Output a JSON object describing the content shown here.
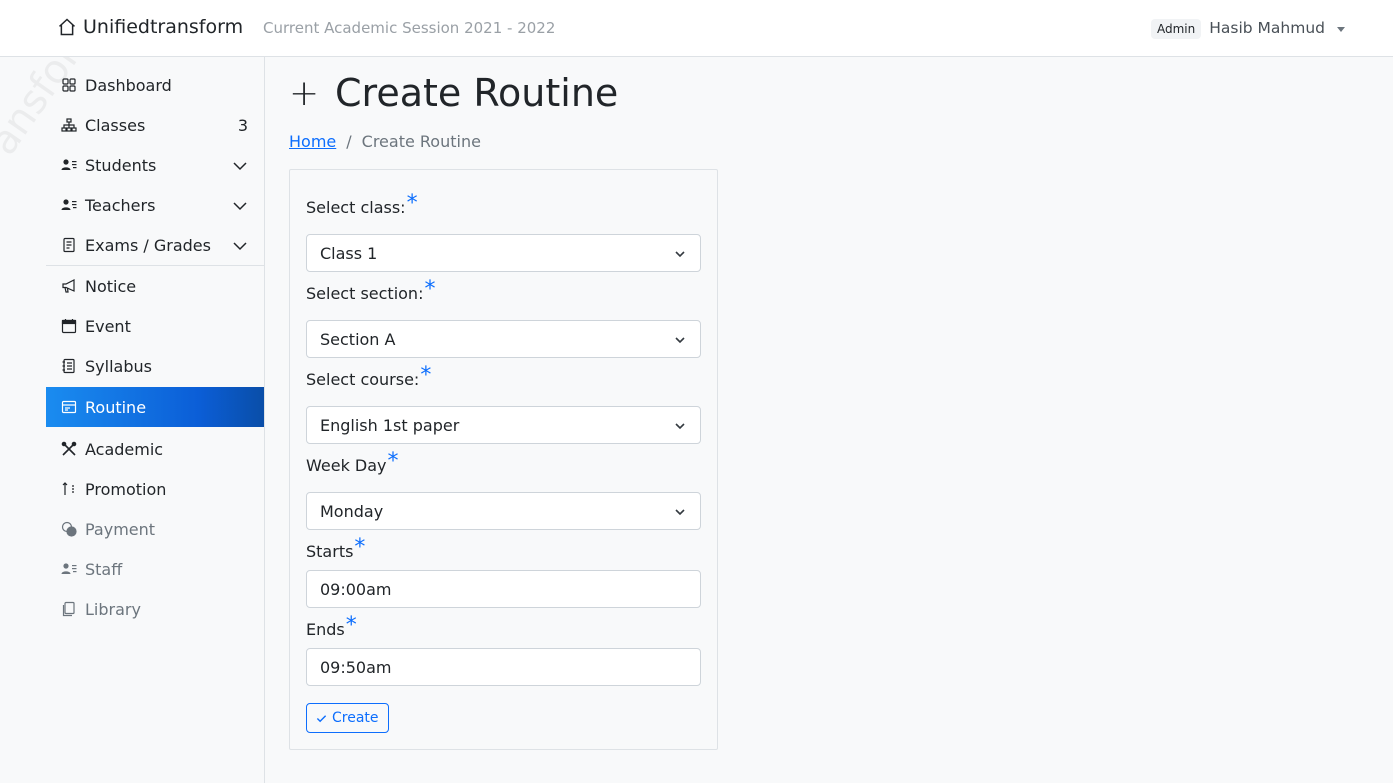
{
  "header": {
    "brand": "Unifiedtransform",
    "session": "Current Academic Session 2021 - 2022",
    "role_badge": "Admin",
    "user_name": "Hasib Mahmud"
  },
  "sidebar": {
    "items": [
      {
        "label": "Dashboard",
        "icon": "dashboard-icon"
      },
      {
        "label": "Classes",
        "icon": "diagram-icon",
        "count": "3"
      },
      {
        "label": "Students",
        "icon": "person-lines-icon",
        "expandable": true
      },
      {
        "label": "Teachers",
        "icon": "person-lines-icon",
        "expandable": true
      },
      {
        "label": "Exams / Grades",
        "icon": "file-text-icon",
        "expandable": true
      },
      {
        "label": "Notice",
        "icon": "megaphone-icon"
      },
      {
        "label": "Event",
        "icon": "calendar-icon"
      },
      {
        "label": "Syllabus",
        "icon": "journal-icon"
      },
      {
        "label": "Routine",
        "icon": "calendar-table-icon",
        "active": true
      },
      {
        "label": "Academic",
        "icon": "tools-icon"
      },
      {
        "label": "Promotion",
        "icon": "sort-arrows-icon"
      },
      {
        "label": "Payment",
        "icon": "coins-icon",
        "disabled": true
      },
      {
        "label": "Staff",
        "icon": "person-lines-icon",
        "disabled": true
      },
      {
        "label": "Library",
        "icon": "books-icon",
        "disabled": true
      }
    ]
  },
  "page": {
    "title": "Create Routine",
    "breadcrumb_home": "Home",
    "breadcrumb_sep": "/",
    "breadcrumb_current": "Create Routine"
  },
  "form": {
    "class_label": "Select class:",
    "class_value": "Class 1",
    "section_label": "Select section:",
    "section_value": "Section A",
    "course_label": "Select course:",
    "course_value": "English 1st paper",
    "weekday_label": "Week Day",
    "weekday_value": "Monday",
    "starts_label": "Starts",
    "starts_value": "09:00am",
    "ends_label": "Ends",
    "ends_value": "09:50am",
    "required_mark": "*",
    "submit_label": "Create"
  },
  "colors": {
    "primary": "#0d6efd",
    "active_nav": "#0b5ed7"
  }
}
